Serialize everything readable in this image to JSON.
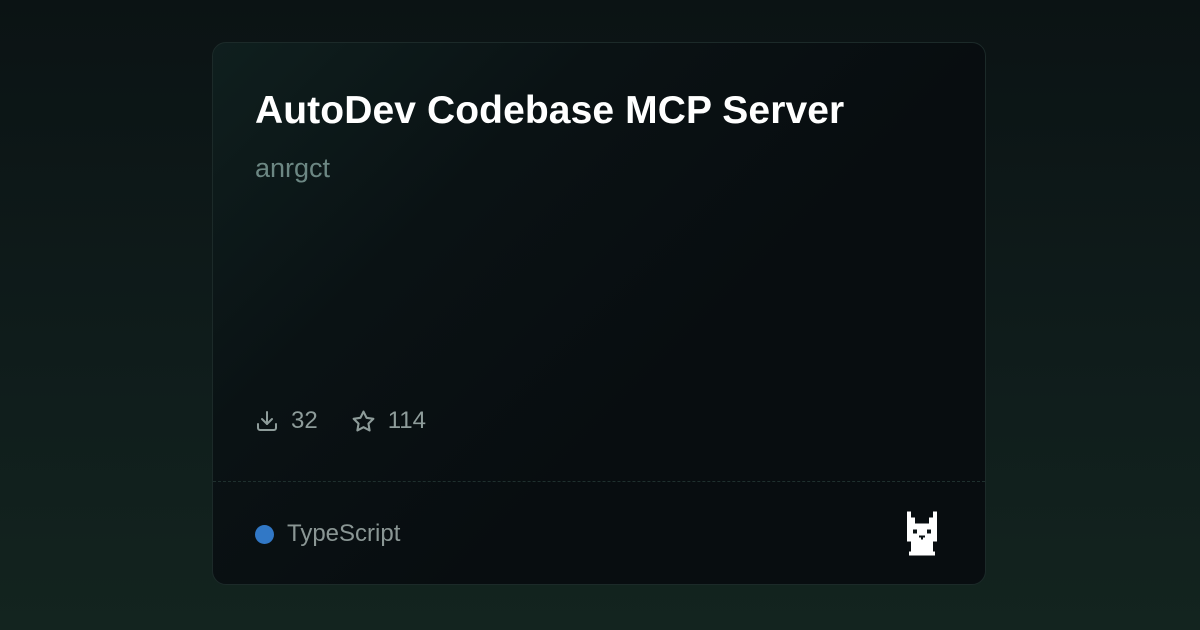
{
  "server": {
    "title": "AutoDev Codebase MCP Server",
    "author": "anrgct",
    "stats": {
      "downloads": "32",
      "stars": "114"
    },
    "language": {
      "name": "TypeScript",
      "color": "#3178c6"
    }
  },
  "icons": {
    "downloads": "download-icon",
    "stars": "star-icon",
    "logo": "llama-logo"
  }
}
